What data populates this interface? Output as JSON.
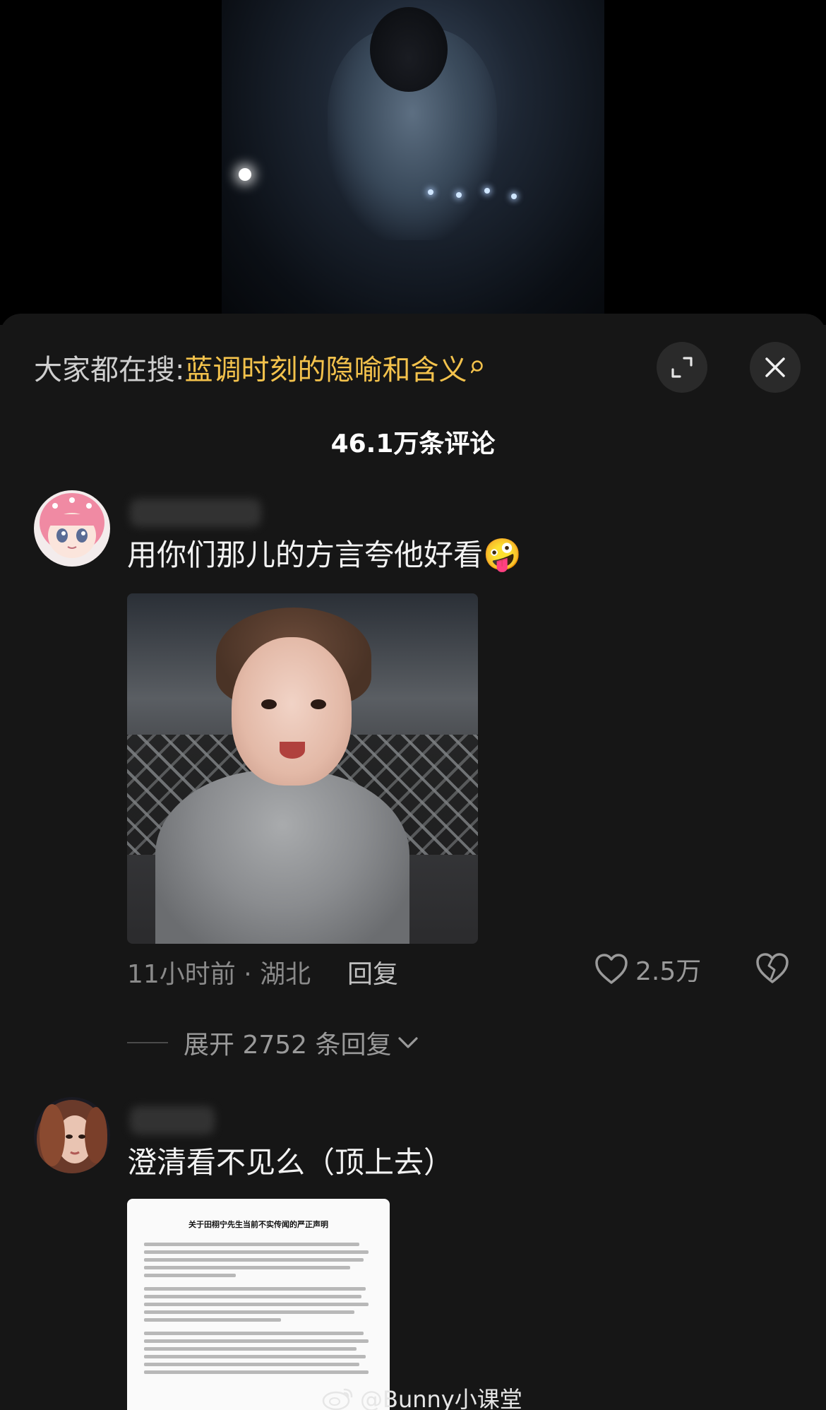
{
  "sheet": {
    "search_prefix": "大家都在搜:",
    "search_term": "蓝调时刻的隐喻和含义",
    "comment_count_title": "46.1万条评论"
  },
  "comments": [
    {
      "text": "用你们那儿的方言夸他好看",
      "emoji": "🤪",
      "meta": "11小时前 · 湖北",
      "reply_label": "回复",
      "likes": "2.5万",
      "expand_label": "展开 2752 条回复"
    },
    {
      "text": "澄清看不见么（顶上去）",
      "doc_title": "关于田栩宁先生当前不实传闻的严正声明"
    }
  ],
  "watermark": {
    "text": "@Bunny小课堂"
  },
  "icons": {
    "expand": "expand-icon",
    "close": "close-icon",
    "search": "search-icon",
    "like": "heart-icon",
    "dislike": "broken-heart-icon",
    "chevron": "chevron-down-icon"
  }
}
